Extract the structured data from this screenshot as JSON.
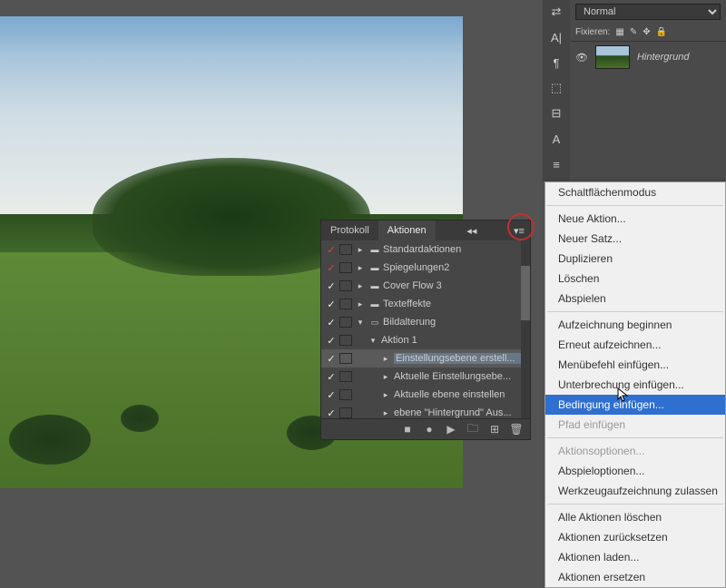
{
  "right": {
    "blend_mode": "Normal",
    "fixieren_label": "Fixieren:",
    "layer_name": "Hintergrund"
  },
  "actions": {
    "tabs": {
      "protokoll": "Protokoll",
      "aktionen": "Aktionen"
    },
    "items": [
      {
        "chk": "red",
        "icon": "folder",
        "label": "Standardaktionen",
        "indent": 0
      },
      {
        "chk": "red",
        "icon": "folder",
        "label": "Spiegelungen2",
        "indent": 0
      },
      {
        "chk": "white",
        "icon": "folder",
        "label": "Cover Flow 3",
        "indent": 0
      },
      {
        "chk": "white",
        "icon": "folder",
        "label": "Texteffekte",
        "indent": 0
      },
      {
        "chk": "white",
        "icon": "folder-open",
        "label": "Bildalterung",
        "indent": 0
      },
      {
        "chk": "white",
        "icon": "action",
        "label": "Aktion 1",
        "indent": 1
      },
      {
        "chk": "white",
        "icon": "step",
        "label": "Einstellungsebene erstell...",
        "indent": 2,
        "selected": true
      },
      {
        "chk": "white",
        "icon": "step",
        "label": "Aktuelle Einstellungsebe...",
        "indent": 2
      },
      {
        "chk": "white",
        "icon": "step",
        "label": "Aktuelle ebene einstellen",
        "indent": 2
      },
      {
        "chk": "white",
        "icon": "step",
        "label": "ebene \"Hintergrund\" Aus...",
        "indent": 2
      }
    ]
  },
  "menu": {
    "groups": [
      [
        {
          "label": "Schaltflächenmodus"
        }
      ],
      [
        {
          "label": "Neue Aktion..."
        },
        {
          "label": "Neuer Satz..."
        },
        {
          "label": "Duplizieren"
        },
        {
          "label": "Löschen"
        },
        {
          "label": "Abspielen"
        }
      ],
      [
        {
          "label": "Aufzeichnung beginnen"
        },
        {
          "label": "Erneut aufzeichnen..."
        },
        {
          "label": "Menübefehl einfügen..."
        },
        {
          "label": "Unterbrechung einfügen..."
        },
        {
          "label": "Bedingung einfügen...",
          "highlighted": true
        },
        {
          "label": "Pfad einfügen",
          "disabled": true
        }
      ],
      [
        {
          "label": "Aktionsoptionen...",
          "disabled": true
        },
        {
          "label": "Abspieloptionen..."
        },
        {
          "label": "Werkzeugaufzeichnung zulassen"
        }
      ],
      [
        {
          "label": "Alle Aktionen löschen"
        },
        {
          "label": "Aktionen zurücksetzen"
        },
        {
          "label": "Aktionen laden..."
        },
        {
          "label": "Aktionen ersetzen"
        }
      ]
    ]
  }
}
